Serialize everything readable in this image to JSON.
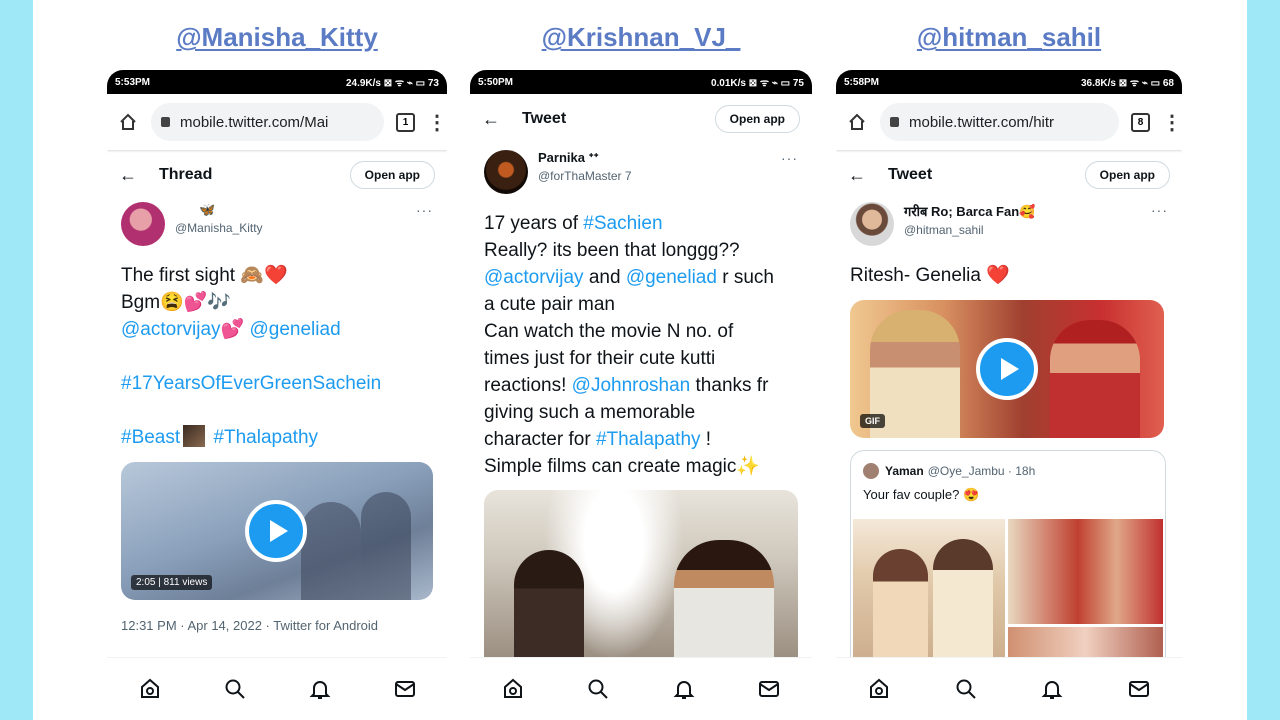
{
  "panels": [
    {
      "handle": "@Manisha_Kitty",
      "status_time": "5:53PM",
      "status_right": "24.9K/s ⊠ ᯤ ⌁ ▭ 73",
      "url": "mobile.twitter.com/Mai",
      "tab_count": "1",
      "header_title": "Thread",
      "open_app": "Open app",
      "display_name": "🦋",
      "username": "@Manisha_Kitty",
      "line1": "The first sight 🙈❤️",
      "line2": "Bgm😫💕🎶",
      "line3_a": "@actorvijay",
      "line3_b": "💕",
      "line3_c": "@geneliad",
      "hashtag1": "#17YearsOfEverGreenSachein",
      "hashtag2": "#Beast",
      "hashtag3": "#Thalapathy",
      "video_meta": "2:05 | 811 views",
      "timestamp": "12:31 PM · Apr 14, 2022 · Twitter for Android",
      "colors": {
        "avatar": "#b03070",
        "media": "#8aa0bb"
      }
    },
    {
      "handle": "@Krishnan_VJ_",
      "status_time": "5:50PM",
      "status_right": "0.01K/s ⊠ ᯤ ⌁ ▭ 75",
      "header_title": "Tweet",
      "open_app": "Open app",
      "display_name": "Parnika ᐩᐩ",
      "username": "@forThaMaster 7",
      "t1a": "17 years of ",
      "t1b": "#Sachien",
      "t2": "Really? its been that longgg??",
      "t3a": "@actorvijay",
      "t3b": " and ",
      "t3c": "@geneliad",
      "t3d": " r such",
      "t4": "a cute pair man",
      "t5": "Can watch the movie N no. of",
      "t6": "times just for their cute kutti",
      "t7a": "reactions! ",
      "t7b": "@Johnroshan",
      "t7c": " thanks fr",
      "t8": "giving such a memorable",
      "t9a": "character for ",
      "t9b": "#Thalapathy",
      "t9c": " !",
      "t10": "Simple films can create magic✨"
    },
    {
      "handle": "@hitman_sahil",
      "status_time": "5:58PM",
      "status_right": "36.8K/s ⊠ ᯤ ⌁ ▭ 68",
      "url": "mobile.twitter.com/hitr",
      "tab_count": "8",
      "header_title": "Tweet",
      "open_app": "Open app",
      "display_name": "गरीब Ro; Barca Fan🥰",
      "username": "@hitman_sahil",
      "body": "Ritesh- Genelia ❤️",
      "gif_label": "GIF",
      "quote_name": "Yaman",
      "quote_meta": "@Oye_Jambu · 18h",
      "quote_text": "Your fav couple? 😍"
    }
  ]
}
